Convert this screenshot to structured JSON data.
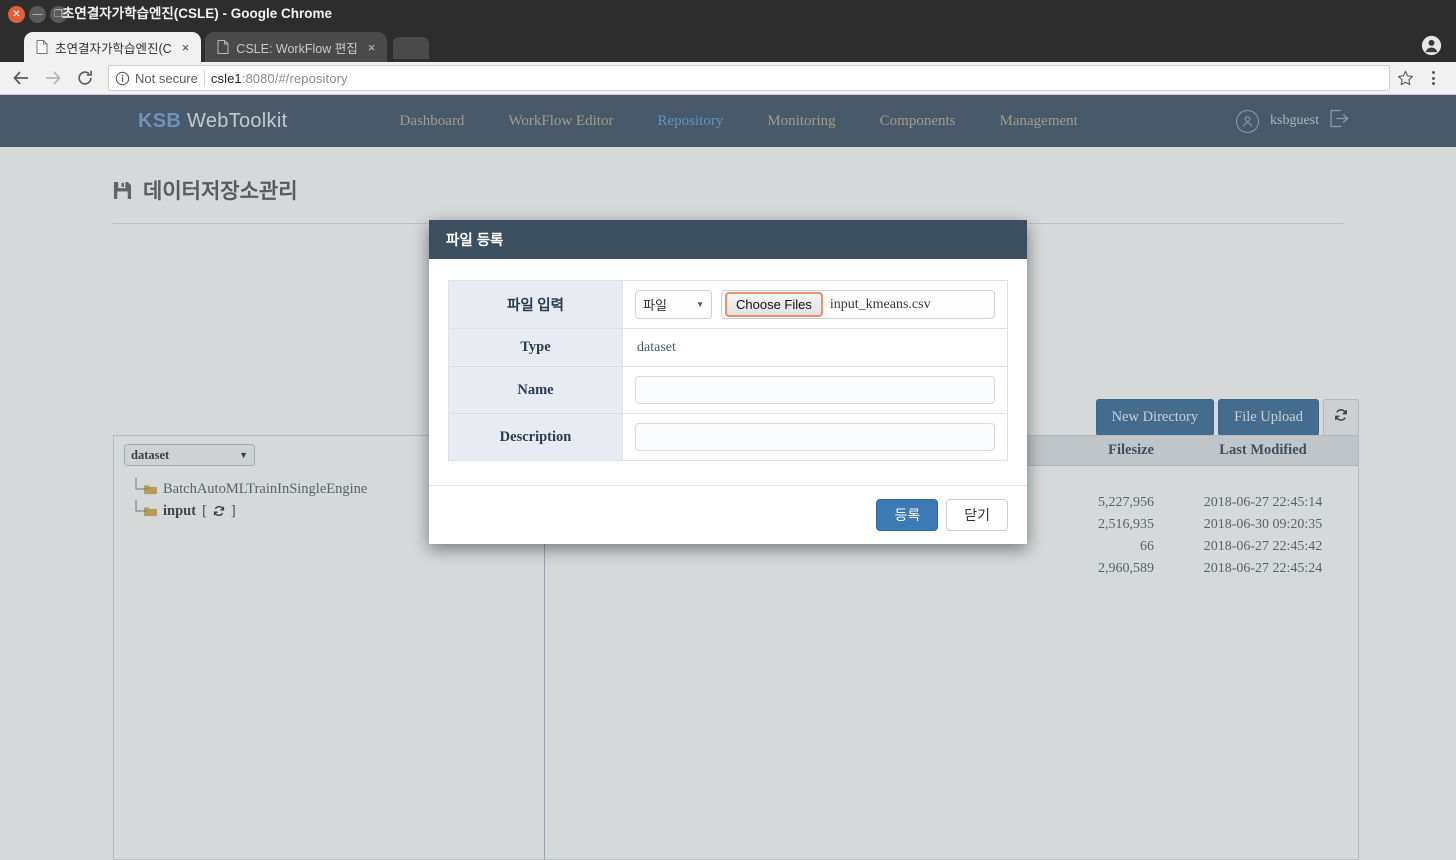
{
  "browser": {
    "window_title": "초연결자가학습엔진(CSLE) - Google Chrome",
    "window_controls": {
      "close": "close-button",
      "minimize": "minimize-button",
      "maximize": "maximize-button"
    },
    "tabs": [
      {
        "title": "초연결자가학습엔진(C",
        "active": true,
        "close": "×"
      },
      {
        "title": "CSLE: WorkFlow 편집",
        "active": false,
        "close": "×"
      }
    ],
    "toolbar": {
      "back": "←",
      "forward": "→",
      "reload": "⟳",
      "security_label": "Not secure",
      "url_host": "csle1",
      "url_rest": ":8080/#/repository",
      "bookmark": "☆"
    }
  },
  "app": {
    "brand_left": "KSB",
    "brand_right": "WebToolkit",
    "nav": [
      {
        "label": "Dashboard",
        "active": false
      },
      {
        "label": "WorkFlow Editor",
        "active": false
      },
      {
        "label": "Repository",
        "active": true
      },
      {
        "label": "Monitoring",
        "active": false
      },
      {
        "label": "Components",
        "active": false
      },
      {
        "label": "Management",
        "active": false
      }
    ],
    "user": "ksbguest"
  },
  "page": {
    "title": "데이터저장소관리",
    "actions": {
      "new_directory": "New Directory",
      "file_upload": "File Upload",
      "refresh": "⟳"
    }
  },
  "tree": {
    "selected_type": "dataset",
    "caret": "▼",
    "items": [
      {
        "label": "BatchAutoMLTrainInSingleEngine",
        "bold": false,
        "refresh": ""
      },
      {
        "label": "input",
        "bold": true,
        "refresh": "⟳"
      }
    ]
  },
  "table": {
    "columns": {
      "name": "",
      "filesize": "Filesize",
      "last_modified": "Last Modified"
    },
    "rows": [
      {
        "name": "",
        "filesize": "5,227,956",
        "last_modified": "2018-06-27 22:45:14"
      },
      {
        "name": "",
        "filesize": "2,516,935",
        "last_modified": "2018-06-30 09:20:35"
      },
      {
        "name": "",
        "filesize": "66",
        "last_modified": "2018-06-27 22:45:42"
      },
      {
        "name": "",
        "filesize": "2,960,589",
        "last_modified": "2018-06-27 22:45:24"
      }
    ]
  },
  "modal": {
    "title": "파일 등록",
    "fields": {
      "file_input_label": "파일 입력",
      "file_kind_value": "파일",
      "file_kind_caret": "▼",
      "choose_files_button": "Choose Files",
      "chosen_file_name": "input_kmeans.csv",
      "type_label": "Type",
      "type_value": "dataset",
      "name_label": "Name",
      "name_value": "",
      "name_placeholder": "",
      "description_label": "Description",
      "description_value": "",
      "description_placeholder": ""
    },
    "submit_label": "등록",
    "close_label": "닫기"
  },
  "colors": {
    "navbar": "#34495e",
    "modal_header": "#3c4f5f",
    "primary_button": "#2f6393",
    "modal_submit": "#3b7ab5",
    "nav_active": "#5b9bd5",
    "folder": "#d4a843",
    "focus_ring": "#e8926c"
  }
}
